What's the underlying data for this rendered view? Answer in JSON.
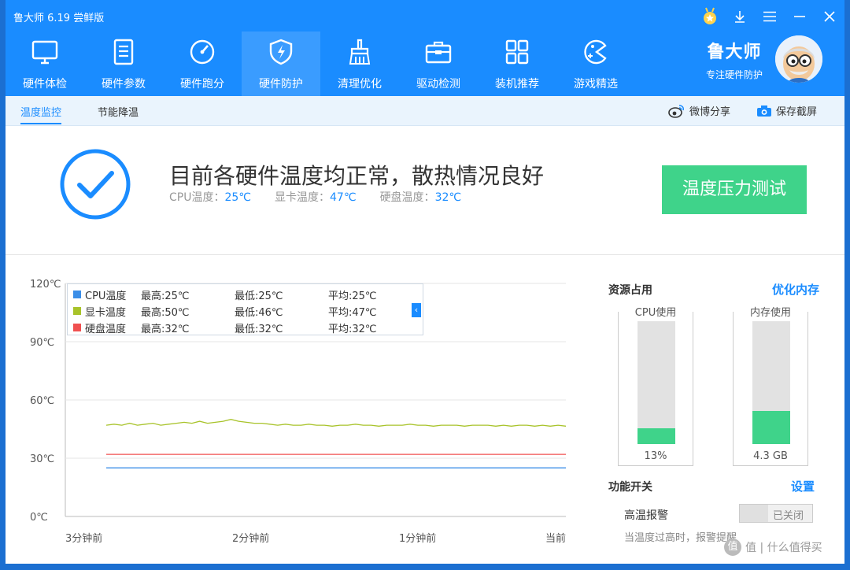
{
  "app": {
    "title": "鲁大师 6.19 尝鲜版"
  },
  "window_controls": [
    {
      "name": "award-icon"
    },
    {
      "name": "download-icon"
    },
    {
      "name": "menu-icon"
    },
    {
      "name": "minimize-icon"
    },
    {
      "name": "close-icon"
    }
  ],
  "nav": {
    "items": [
      {
        "label": "硬件体检",
        "icon": "monitor-icon"
      },
      {
        "label": "硬件参数",
        "icon": "document-icon"
      },
      {
        "label": "硬件跑分",
        "icon": "gauge-icon"
      },
      {
        "label": "硬件防护",
        "icon": "shield-icon",
        "active": true
      },
      {
        "label": "清理优化",
        "icon": "broom-icon"
      },
      {
        "label": "驱动检测",
        "icon": "toolbox-icon"
      },
      {
        "label": "装机推荐",
        "icon": "grid-icon"
      },
      {
        "label": "游戏精选",
        "icon": "gamepad-icon"
      }
    ]
  },
  "brand": {
    "name": "鲁大师",
    "slogan": "专注硬件防护"
  },
  "subnav": {
    "tabs": [
      {
        "label": "温度监控",
        "active": true
      },
      {
        "label": "节能降温",
        "active": false
      }
    ],
    "actions": [
      {
        "label": "微博分享",
        "icon": "weibo-icon"
      },
      {
        "label": "保存截屏",
        "icon": "camera-icon"
      }
    ]
  },
  "status": {
    "title": "目前各硬件温度均正常，散热情况良好",
    "cpu_label": "CPU温度：",
    "cpu_value": "25℃",
    "gpu_label": "显卡温度：",
    "gpu_value": "47℃",
    "disk_label": "硬盘温度：",
    "disk_value": "32℃",
    "button": "温度压力测试"
  },
  "chart_data": {
    "type": "line",
    "ylim": [
      0,
      120
    ],
    "yticks": [
      "0℃",
      "30℃",
      "60℃",
      "90℃",
      "120℃"
    ],
    "xticks": [
      "3分钟前",
      "2分钟前",
      "1分钟前",
      "当前"
    ],
    "legend": [
      {
        "name": "CPU温度",
        "max": "最高:25℃",
        "min": "最低:25℃",
        "avg": "平均:25℃",
        "color": "#3b8ee8"
      },
      {
        "name": "显卡温度",
        "max": "最高:50℃",
        "min": "最低:46℃",
        "avg": "平均:47℃",
        "color": "#a8c32a"
      },
      {
        "name": "硬盘温度",
        "max": "最高:32℃",
        "min": "最低:32℃",
        "avg": "平均:32℃",
        "color": "#f05050"
      }
    ],
    "series": [
      {
        "name": "CPU温度",
        "color": "#3b8ee8",
        "values": [
          25,
          25,
          25,
          25,
          25,
          25,
          25,
          25,
          25,
          25,
          25,
          25,
          25,
          25,
          25,
          25,
          25,
          25,
          25,
          25,
          25,
          25,
          25,
          25,
          25,
          25,
          25,
          25,
          25,
          25,
          25,
          25,
          25,
          25,
          25,
          25,
          25,
          25,
          25,
          25,
          25,
          25,
          25,
          25,
          25,
          25,
          25,
          25,
          25,
          25,
          25,
          25,
          25,
          25,
          25,
          25,
          25,
          25,
          25,
          25
        ]
      },
      {
        "name": "显卡温度",
        "color": "#a8c32a",
        "values": [
          47,
          47.5,
          47,
          48,
          47,
          47.5,
          48,
          47,
          47.5,
          48,
          48.5,
          48,
          49,
          48,
          48.5,
          49,
          50,
          49,
          48.5,
          48,
          48,
          47.5,
          47,
          47.5,
          47,
          47,
          47.5,
          47,
          47,
          46.5,
          47,
          47,
          47.5,
          47,
          47,
          46.5,
          47,
          47,
          47,
          47.5,
          47,
          47,
          46.5,
          47,
          47,
          47,
          46.5,
          47,
          47,
          47,
          46.5,
          47,
          46.5,
          47,
          47,
          46.5,
          47,
          46.5,
          47,
          46.5
        ]
      },
      {
        "name": "硬盘温度",
        "color": "#f05050",
        "values": [
          32,
          32,
          32,
          32,
          32,
          32,
          32,
          32,
          32,
          32,
          32,
          32,
          32,
          32,
          32,
          32,
          32,
          32,
          32,
          32,
          32,
          32,
          32,
          32,
          32,
          32,
          32,
          32,
          32,
          32,
          32,
          32,
          32,
          32,
          32,
          32,
          32,
          32,
          32,
          32,
          32,
          32,
          32,
          32,
          32,
          32,
          32,
          32,
          32,
          32,
          32,
          32,
          32,
          32,
          32,
          32,
          32,
          32,
          32,
          32
        ]
      }
    ]
  },
  "resources": {
    "title": "资源占用",
    "optimize_link": "优化内存",
    "cpu": {
      "label": "CPU使用",
      "value": "13%",
      "fraction": 0.13
    },
    "memory": {
      "label": "内存使用",
      "value": "4.3 GB",
      "fraction": 0.27
    }
  },
  "features": {
    "title": "功能开关",
    "settings_link": "设置",
    "toggle_label": "高温报警",
    "toggle_state": "已关闭",
    "hint": "当温度过高时，报警提醒"
  },
  "watermark": {
    "text": "值 | 什么值得买",
    "icon": "值"
  }
}
